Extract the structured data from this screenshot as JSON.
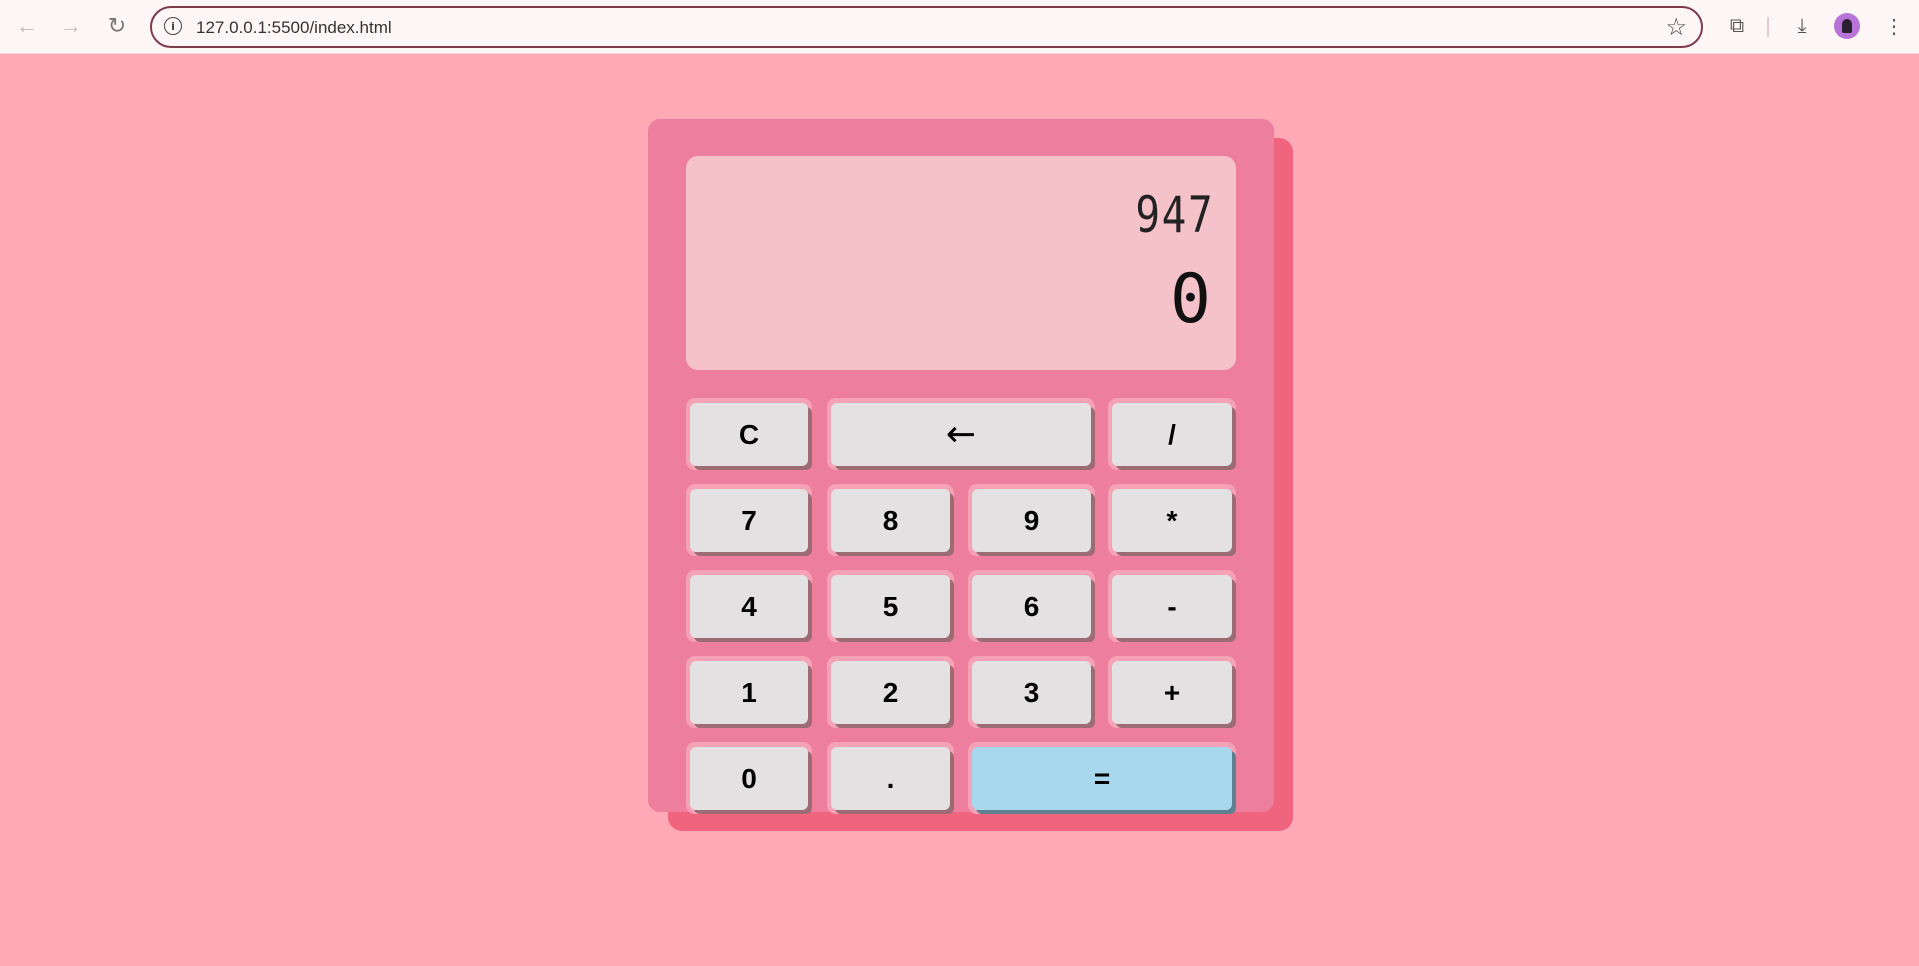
{
  "browser": {
    "url": "127.0.0.1:5500/index.html",
    "back_icon": "←",
    "forward_icon": "→",
    "reload_icon": "↻",
    "info_icon": "i",
    "star_icon": "☆",
    "extensions_icon": "⧉",
    "download_icon": "⤓",
    "menu_icon": "⋮"
  },
  "calculator": {
    "previous_operand": "947",
    "current_operand": "0",
    "keys": {
      "clear": "C",
      "backspace": "←",
      "divide": "/",
      "seven": "7",
      "eight": "8",
      "nine": "9",
      "multiply": "*",
      "four": "4",
      "five": "5",
      "six": "6",
      "subtract": "-",
      "one": "1",
      "two": "2",
      "three": "3",
      "add": "+",
      "zero": "0",
      "decimal": ".",
      "equals": "="
    }
  },
  "colors": {
    "page_background": "#ffa8b6",
    "calculator_body": "#ed7e9e",
    "calculator_side": "#f0647d",
    "display_background": "#f5c2ca",
    "key_face": "#e3e1e1",
    "equals_key": "#a8d8ee"
  }
}
